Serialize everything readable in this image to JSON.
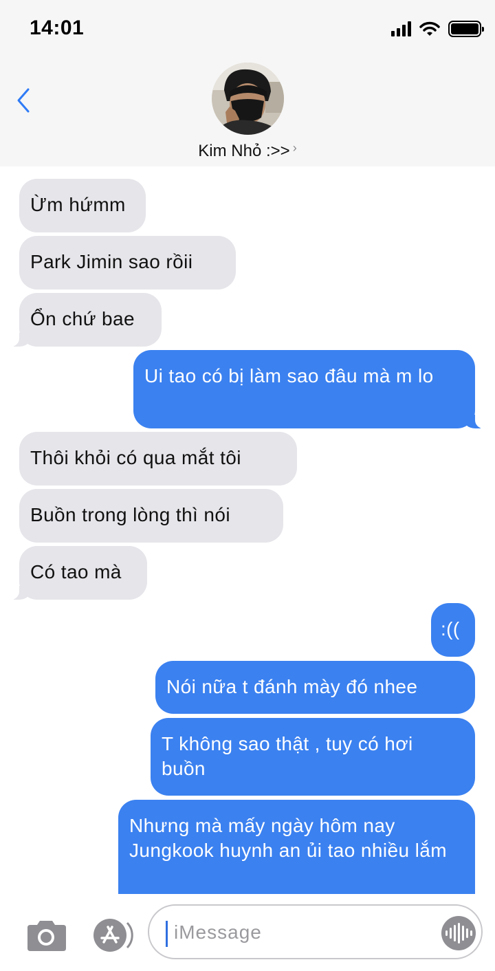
{
  "status_bar": {
    "time": "14:01",
    "icons": [
      "cellular-signal-icon",
      "wifi-icon",
      "battery-icon"
    ]
  },
  "header": {
    "back_icon": "chevron-left-icon",
    "contact_name": "Kim Nhỏ :>>",
    "contact_chevron": "›"
  },
  "messages": [
    {
      "direction": "incoming",
      "text": "Ừm hứmm"
    },
    {
      "direction": "incoming",
      "text": "Park Jimin sao rồii"
    },
    {
      "direction": "incoming",
      "text": "Ổn chứ bae"
    },
    {
      "direction": "outgoing",
      "text": "Ui tao có bị làm sao đâu mà m lo"
    },
    {
      "direction": "incoming",
      "text": "Thôi khỏi có qua mắt tôi"
    },
    {
      "direction": "incoming",
      "text": "Buồn trong lòng thì nói"
    },
    {
      "direction": "incoming",
      "text": "Có tao mà"
    },
    {
      "direction": "outgoing",
      "text": ":(("
    },
    {
      "direction": "outgoing",
      "text": "Nói nữa t đánh mày đó nhee"
    },
    {
      "direction": "outgoing",
      "text": "T không sao thật , tuy có hơi buồn"
    },
    {
      "direction": "outgoing",
      "text": "Nhưng mà mấy ngày hôm nay Jungkook huynh an ủi tao nhiều lắm"
    }
  ],
  "composer": {
    "placeholder": "iMessage",
    "value": "",
    "camera_icon": "camera-icon",
    "apps_icon": "app-store-icon",
    "audio_icon": "audio-waveform-icon"
  },
  "colors": {
    "outgoing": "#3b81f0",
    "incoming": "#e5e5ea",
    "accent": "#2f7bf6",
    "header_bg": "#f6f6f6"
  }
}
